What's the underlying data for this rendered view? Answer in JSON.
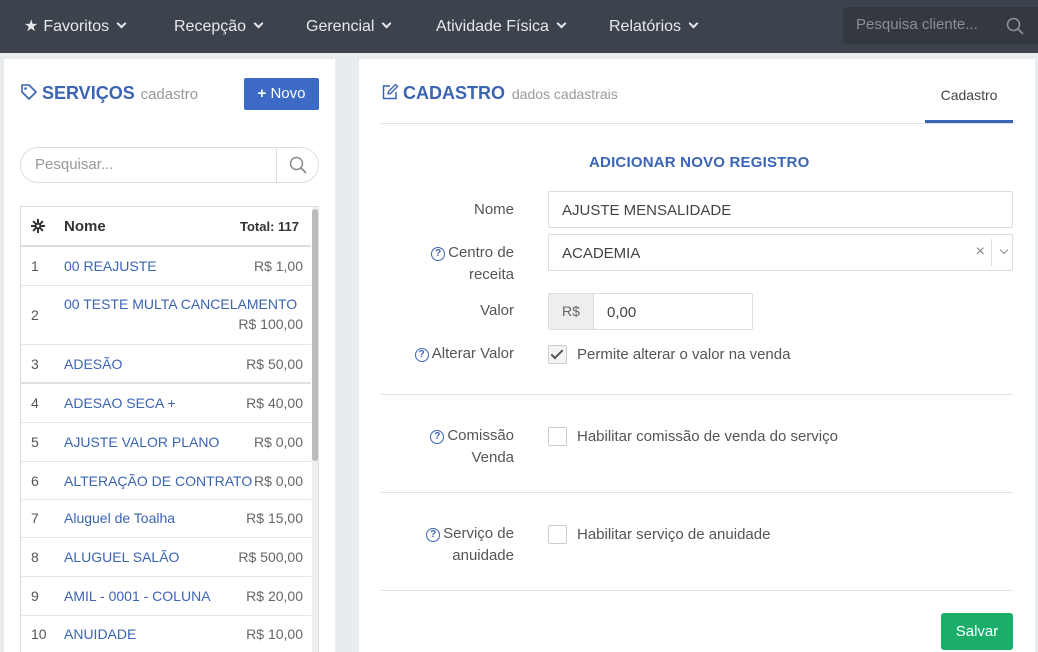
{
  "nav": {
    "items": [
      {
        "label": "Favoritos"
      },
      {
        "label": "Recepção"
      },
      {
        "label": "Gerencial"
      },
      {
        "label": "Atividade Física"
      },
      {
        "label": "Relatórios"
      }
    ],
    "search_placeholder": "Pesquisa cliente..."
  },
  "services": {
    "title": "SERVIÇOS",
    "subtitle": "cadastro",
    "new_button": "Novo",
    "search_placeholder": "Pesquisar...",
    "table": {
      "col_name": "Nome",
      "total": "Total: 117",
      "rows": [
        {
          "idx": "1",
          "name": "00 REAJUSTE",
          "price": "R$ 1,00"
        },
        {
          "idx": "2",
          "name": "00 TESTE MULTA CANCELAMENTO",
          "price": "R$ 100,00"
        },
        {
          "idx": "3",
          "name": "ADESÃO",
          "price": "R$ 50,00"
        },
        {
          "idx": "4",
          "name": "ADESAO SECA +",
          "price": "R$ 40,00"
        },
        {
          "idx": "5",
          "name": "AJUSTE VALOR PLANO",
          "price": "R$ 0,00"
        },
        {
          "idx": "6",
          "name": "ALTERAÇÃO DE CONTRATO",
          "price": "R$ 0,00"
        },
        {
          "idx": "7",
          "name": "Aluguel de Toalha",
          "price": "R$ 15,00"
        },
        {
          "idx": "8",
          "name": "ALUGUEL SALÃO",
          "price": "R$ 500,00"
        },
        {
          "idx": "9",
          "name": "AMIL - 0001 - COLUNA",
          "price": "R$ 20,00"
        },
        {
          "idx": "10",
          "name": "ANUIDADE",
          "price": "R$ 10,00"
        }
      ]
    }
  },
  "form": {
    "title": "CADASTRO",
    "subtitle": "dados cadastrais",
    "tab": "Cadastro",
    "heading": "ADICIONAR NOVO REGISTRO",
    "nome_label": "Nome",
    "nome_value": "AJUSTE MENSALIDADE",
    "centro_label_1": "Centro de",
    "centro_label_2": "receita",
    "centro_value": "ACADEMIA",
    "valor_label": "Valor",
    "valor_prefix": "R$",
    "valor_value": "0,00",
    "alterar_label": "Alterar Valor",
    "alterar_text": "Permite alterar o valor na venda",
    "alterar_checked": true,
    "comissao_label_1": "Comissão",
    "comissao_label_2": "Venda",
    "comissao_text": "Habilitar comissão de venda do serviço",
    "comissao_checked": false,
    "anuidade_label_1": "Serviço de",
    "anuidade_label_2": "anuidade",
    "anuidade_text": "Habilitar serviço de anuidade",
    "anuidade_checked": false,
    "save_button": "Salvar"
  }
}
